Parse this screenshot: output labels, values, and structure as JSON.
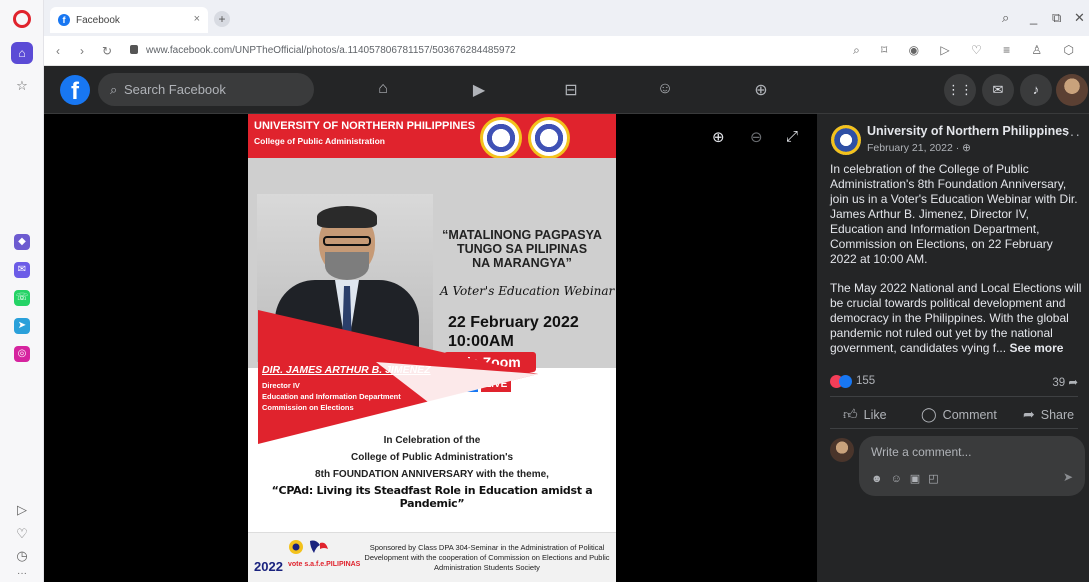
{
  "browser": {
    "tab_title": "Facebook",
    "url": "www.facebook.com/UNPTheOfficial/photos/a.114057806781157/503676284485972"
  },
  "facebook": {
    "search_placeholder": "Search Facebook"
  },
  "poster": {
    "university": "UNIVERSITY OF NORTHERN PHILIPPINES",
    "college": "College of Public Administration",
    "quote_line1": "“MATALINONG PAGPASYA",
    "quote_line2": "TUNGO SA PILIPINAS",
    "quote_line3": "NA MARANGYA”",
    "webinar": "A Voter's Education Webinar",
    "date": "22 February 2022",
    "time": "10:00AM",
    "platform": "via Zoom",
    "live": "LIVE",
    "speaker_name": "DIR. JAMES ARTHUR B. JIMENEZ",
    "speaker_title": "Director IV",
    "speaker_dept": "Education and Information Department",
    "speaker_org": "Commission on Elections",
    "celebration_line1": "In Celebration of the",
    "celebration_line2": "College of Public Administration's",
    "celebration_line3": "8th FOUNDATION ANNIVERSARY with the theme,",
    "theme": "“CPAd: Living its Steadfast Role in Education amidst a Pandemic”",
    "footer_year": "2022",
    "footer_brand": "vote s.a.f.e.PILIPINAS",
    "sponsor": "Sponsored by Class DPA 304-Seminar in the Administration of Political Development with the cooperation of Commission on Elections and Public Administration Students Society"
  },
  "post": {
    "page_name": "University of Northern Philippines",
    "date": "February 21, 2022 ·",
    "paragraph1": "In celebration of the College of Public Administration's 8th Foundation Anniversary, join us in a Voter's Education Webinar with Dir. James Arthur B. Jimenez, Director IV, Education and Information Department, Commission on Elections, on 22 February 2022 at 10:00 AM.",
    "paragraph2": "The May 2022 National and Local Elections will be crucial towards political development and democracy in the Philippines. With the global pandemic not ruled out yet by the national government, candidates vying f...",
    "see_more": "See more",
    "reaction_count": "155",
    "share_count": "39",
    "like_label": "Like",
    "comment_label": "Comment",
    "share_label": "Share",
    "comment_placeholder": "Write a comment..."
  },
  "colors": {
    "facebook_blue": "#1877f2",
    "poster_red": "#e0232d",
    "dark_bg": "#242526"
  }
}
